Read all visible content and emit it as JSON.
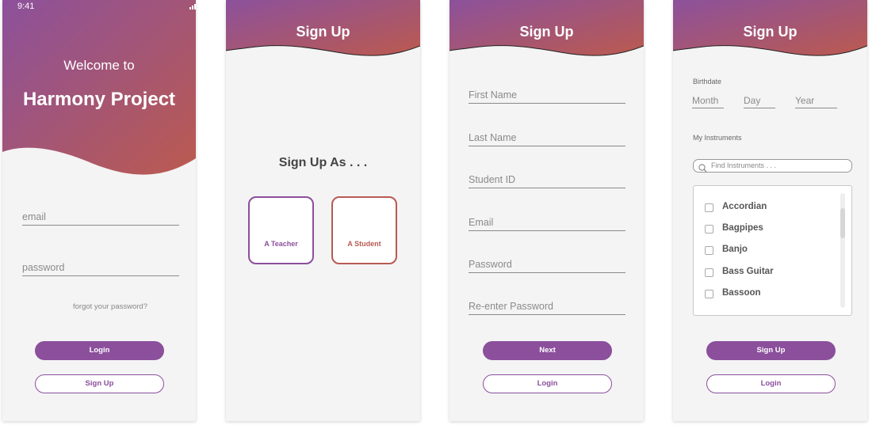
{
  "colors": {
    "gradient_start": "#8c519c",
    "gradient_end": "#bb5a4f",
    "accent": "#8b4f9c",
    "student_accent": "#b85a52",
    "background": "#f4f4f4"
  },
  "login_screen": {
    "status_time": "9:41",
    "welcome": "Welcome to",
    "app_name": "Harmony Project",
    "email_placeholder": "email",
    "password_placeholder": "password",
    "forgot_link": "forgot your password?",
    "login_button": "Login",
    "signup_button": "Sign Up"
  },
  "role_screen": {
    "title": "Sign Up",
    "prompt": "Sign Up As . . .",
    "teacher_option": "A Teacher",
    "student_option": "A Student"
  },
  "details_screen": {
    "title": "Sign Up",
    "fields": [
      "First Name",
      "Last Name",
      "Student ID",
      "Email",
      "Password",
      "Re-enter Password"
    ],
    "next_button": "Next",
    "login_button": "Login"
  },
  "instruments_screen": {
    "title": "Sign Up",
    "birthdate_label": "Birthdate",
    "month": "Month",
    "day": "Day",
    "year": "Year",
    "instruments_label": "My Instruments",
    "search_placeholder": "Find Instruments . . .",
    "instruments": [
      "Accordian",
      "Bagpipes",
      "Banjo",
      "Bass Guitar",
      "Bassoon"
    ],
    "signup_button": "Sign Up",
    "login_button": "Login"
  }
}
